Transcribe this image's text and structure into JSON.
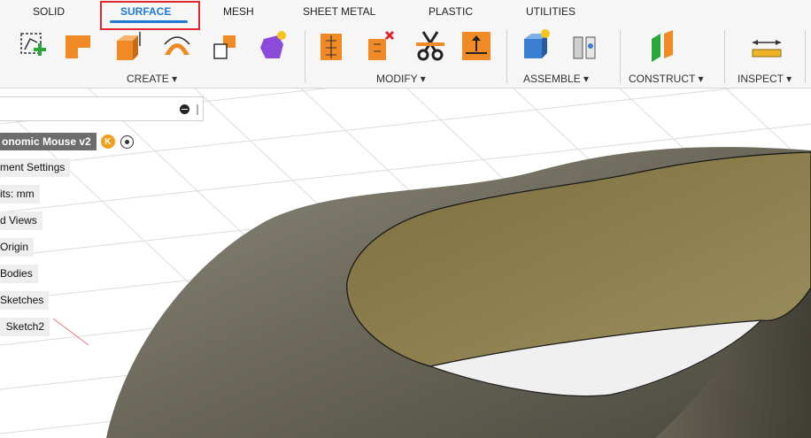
{
  "tabs": [
    {
      "label": "SOLID"
    },
    {
      "label": "SURFACE"
    },
    {
      "label": "MESH"
    },
    {
      "label": "SHEET METAL"
    },
    {
      "label": "PLASTIC"
    },
    {
      "label": "UTILITIES"
    }
  ],
  "active_tab": "SURFACE",
  "groups": {
    "create": "CREATE ▾",
    "modify": "MODIFY ▾",
    "assemble": "ASSEMBLE ▾",
    "construct": "CONSTRUCT ▾",
    "inspect": "INSPECT ▾"
  },
  "tools": {
    "create": [
      "create-sketch-icon",
      "extrude-icon",
      "revolve-icon",
      "sweep-icon",
      "loft-icon",
      "patch-icon"
    ],
    "modify": [
      "trim-icon",
      "untrim-icon",
      "split-body-icon",
      "offset-icon"
    ],
    "assemble": [
      "new-component-icon",
      "joint-icon"
    ],
    "construct": [
      "plane-icon"
    ],
    "inspect": [
      "measure-icon"
    ]
  },
  "browser": {
    "root_label": "onomic Mouse v2",
    "root_badge": "K",
    "nodes": [
      {
        "label": "ment Settings"
      },
      {
        "label": "its: mm"
      },
      {
        "label": "d Views"
      },
      {
        "label": "Origin"
      },
      {
        "label": "Bodies"
      },
      {
        "label": "Sketches"
      },
      {
        "label": "  Sketch2"
      }
    ]
  },
  "colors": {
    "accent": "#1f7bd6",
    "highlight": "#e0262e",
    "tool_orange": "#f08a24",
    "surface_inner": "#8a7b4a",
    "surface_outer": "#6e6a5c"
  }
}
